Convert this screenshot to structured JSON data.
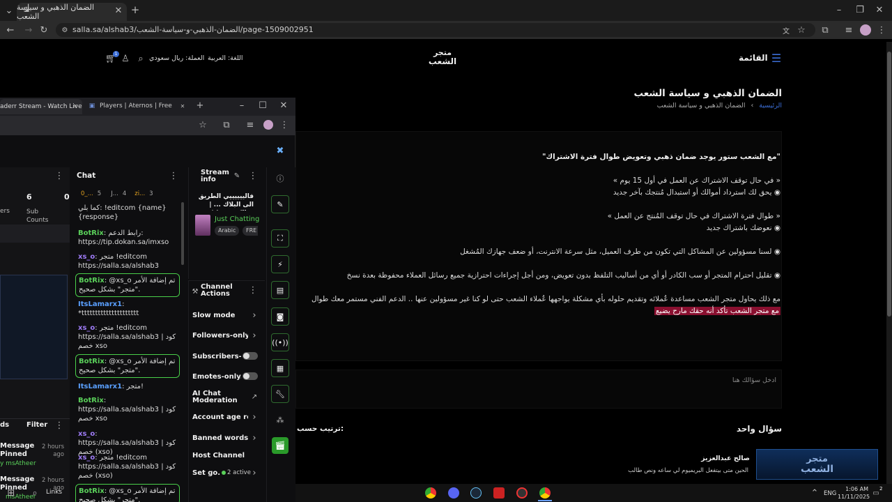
{
  "browser": {
    "tab_title": "الضمان الذهبي و سياسة الشعب",
    "url": "salla.sa/alshab3/الضمان-الذهبي-و-سياسة-الشعب/page-1509002951"
  },
  "site": {
    "menu_label": "القائمة",
    "logo_line1": "متجر",
    "logo_line2": "الشعب",
    "currency": "العملة: ريال سعودي",
    "language": "اللغة: العربية",
    "cart_count": "1",
    "page_title": "الضمان الذهبي و سياسة الشعب",
    "breadcrumb_home": "الرئيسية",
    "breadcrumb_current": "الضمان الذهبي و سياسة الشعب",
    "content": {
      "heading": "\"مع الشعب ستور يوجد ضمان ذهبي وتعويض طوال فترة الاشتراك\"",
      "l1": "« في حال توقف الاشتراك عن العمل في أول 15 يوم »",
      "l2": "◉ يحق لك استرداد أموالك أو استبدال مُنتجك بآخر جديد",
      "l3": "« طوال فترة الاشتراك في حال توقف المُنتج عن العمل »",
      "l4": "◉ نعوضك باشتراك جديد",
      "l5": "◉ لسنا مسؤولين عن المشاكل التي تكون من طرف العميل، مثل سرعة الانترنت، أو ضعف جهازك المُشغل",
      "l6": "◉ تقليل احترام المتجر أو سب الكادر أو أي من أساليب التلفظ بدون تعويض، ومن أجل إجراءات احترازية جميع رسائل العملاء محفوظة بعدة نسخ",
      "l7": "مع ذلك يحاول متجر الشعب مساعدة عُملائه وتقديم حلوله بأي مشكلة يواجهها عُملاء الشعب حتى لو كنا غير مسؤولين عنها .. الدعم الفني مستمر معك طوال فترة الاشتراك",
      "l8": "مع متجر الشعب تأكد أنه حقك مارح يضيع"
    },
    "question_placeholder": "ادخل سؤالك هنا",
    "one_question": "سؤال واحد",
    "sort_label": "ترتيب حسب:",
    "review_name": "صالح عبدالعزيز",
    "review_text": "الحين متى بيتفعل البريميوم لي ساعه ونص طالب",
    "overlay_logo1": "متجر",
    "overlay_logo2": "الشعب"
  },
  "popup": {
    "tab1": "aderr Stream - Watch Live",
    "tab2": "Players | Aternos | Free Minecra",
    "stats": {
      "num1": "6",
      "label1": "Sub Counts",
      "num2": "0",
      "label0": "ers"
    },
    "chat_title": "Chat",
    "chat_users": [
      "0_...",
      "5",
      "J...",
      "4",
      "zi...",
      "3"
    ],
    "messages": [
      {
        "user": "",
        "text": "كما بلي: !editcom {name} {response}"
      },
      {
        "user": "BotRix",
        "text": "رابط الدعم: https://tip.dokan.sa/imxso"
      },
      {
        "user": "xs_o",
        "text": "متجر !editcom https://salla.sa/alshab3"
      },
      {
        "user": "BotRix",
        "text": "@xs_o تم إضافة الأمر \"متجر\" بشكل صحيح."
      },
      {
        "user": "ItsLamarx1",
        "text": "*ttttttttttttttttttttt"
      },
      {
        "user": "xs_o",
        "text": "متجر !editcom https://salla.sa/alshab3 | كود خصم xso"
      },
      {
        "user": "BotRix",
        "text": "@xs_o تم إضافة الأمر \"متجر\" بشكل صحيح."
      },
      {
        "user": "ItsLamarx1",
        "text": "متجر!"
      },
      {
        "user": "BotRix",
        "text": "https://salla.sa/alshab3 | كود خصم xso"
      },
      {
        "user": "xs_o",
        "text": "https://salla.sa/alshab3 | كود خصم (xso)"
      },
      {
        "user": "xs_o",
        "text": "متجر !editcom https://salla.sa/alshab3 | كود خصم (xso)"
      },
      {
        "user": "BotRix",
        "text": "@xs_o تم إضافة الأمر \"متجر\" بشكل صحيح."
      }
    ],
    "stream_info_title": "Stream info",
    "stream_title": "فالييييييي الطريق الى البلاك ... | حيالكمممم | !",
    "category": "Just Chatting",
    "tag1": "Arabic",
    "tag2": "FRE",
    "channel_actions_title": "Channel Actions",
    "actions": [
      "Slow mode",
      "Followers-only ch",
      "Subscribers-...",
      "Emotes-only...",
      "AI Chat Moderation",
      "Account age restr",
      "Banned words",
      "Host Channel",
      "Set go..."
    ],
    "set_goal_status": "2 active",
    "mod_filter": "Filter",
    "mod_label": "ds",
    "pinned1": "Message Pinned",
    "pinned1_by": "y msAtheer",
    "pinned1_time": "2 hours ago",
    "pinned2": "Message Pinned",
    "pinned2_by": "msAtheer",
    "pinned2_time": "2 hours ago",
    "links": "Links"
  },
  "taskbar": {
    "lang": "ENG",
    "time": "1:06 AM",
    "date": "11/11/2025",
    "notif": "2"
  }
}
